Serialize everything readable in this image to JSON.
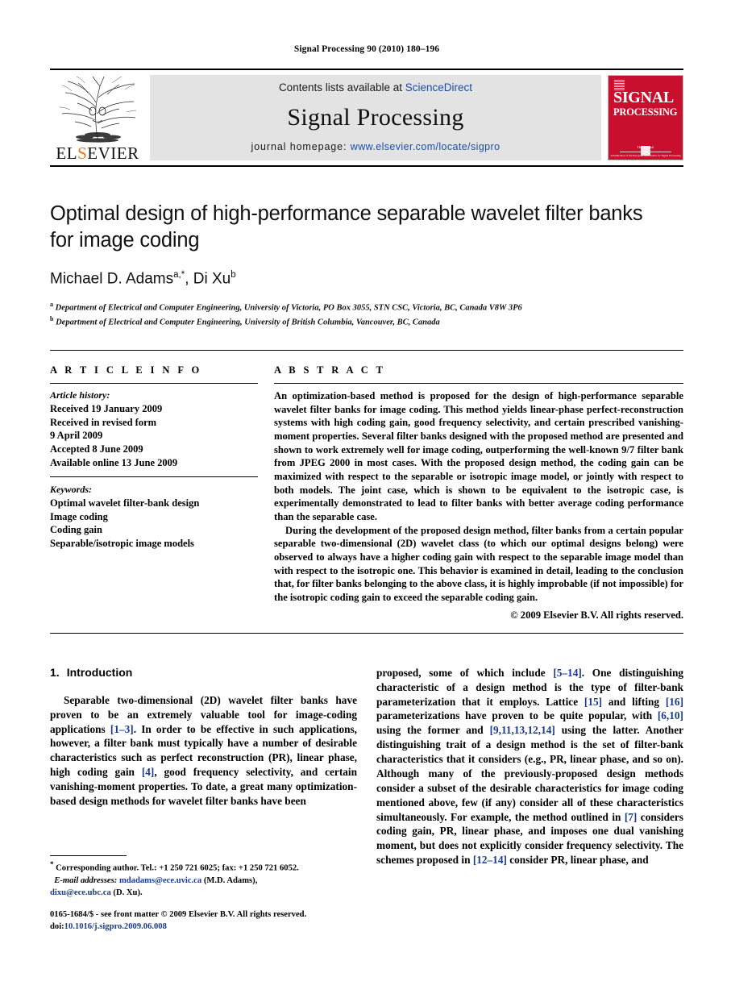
{
  "running_head": "Signal Processing 90 (2010) 180–196",
  "masthead": {
    "publisher": "ELSEVIER",
    "contents_prefix": "Contents lists available at ",
    "contents_link": "ScienceDirect",
    "journal_title": "Signal Processing",
    "homepage_prefix": "journal homepage: ",
    "homepage_url": "www.elsevier.com/locate/sigpro",
    "cover": {
      "line1": "SIGNAL",
      "line2": "PROCESSING",
      "tagline": "The Journal",
      "subtagline": "A Publication of the European Association for Signal Processing"
    },
    "accent_red": "#c8102e",
    "link_blue": "#1c4ea8"
  },
  "article": {
    "title": "Optimal design of high-performance separable wavelet filter banks for image coding",
    "authors": "Michael D. Adams, Di Xu",
    "author_1_name": "Michael D. Adams",
    "author_1_marks": "a,*",
    "author_2_name": "Di Xu",
    "author_2_marks": "b",
    "affiliation_a_mark": "a",
    "affiliation_a": "Department of Electrical and Computer Engineering, University of Victoria, PO Box 3055, STN CSC, Victoria, BC, Canada V8W 3P6",
    "affiliation_b_mark": "b",
    "affiliation_b": "Department of Electrical and Computer Engineering, University of British Columbia, Vancouver, BC, Canada"
  },
  "article_info": {
    "label": "A R T I C L E  I N F O",
    "history_head": "Article history:",
    "history": [
      "Received 19 January 2009",
      "Received in revised form",
      "9 April 2009",
      "Accepted 8 June 2009",
      "Available online 13 June 2009"
    ],
    "keywords_head": "Keywords:",
    "keywords": [
      "Optimal wavelet filter-bank design",
      "Image coding",
      "Coding gain",
      "Separable/isotropic image models"
    ]
  },
  "abstract": {
    "label": "A B S T R A C T",
    "paragraph_1": "An optimization-based method is proposed for the design of high-performance separable wavelet filter banks for image coding. This method yields linear-phase perfect-reconstruction systems with high coding gain, good frequency selectivity, and certain prescribed vanishing-moment properties. Several filter banks designed with the proposed method are presented and shown to work extremely well for image coding, outperforming the well-known 9/7 filter bank from JPEG 2000 in most cases. With the proposed design method, the coding gain can be maximized with respect to the separable or isotropic image model, or jointly with respect to both models. The joint case, which is shown to be equivalent to the isotropic case, is experimentally demonstrated to lead to filter banks with better average coding performance than the separable case.",
    "paragraph_2": "During the development of the proposed design method, filter banks from a certain popular separable two-dimensional (2D) wavelet class (to which our optimal designs belong) were observed to always have a higher coding gain with respect to the separable image model than with respect to the isotropic one. This behavior is examined in detail, leading to the conclusion that, for filter banks belonging to the above class, it is highly improbable (if not impossible) for the isotropic coding gain to exceed the separable coding gain.",
    "copyright": "© 2009 Elsevier B.V. All rights reserved."
  },
  "introduction": {
    "number": "1.",
    "heading": "Introduction",
    "left_text_1": "Separable two-dimensional (2D) wavelet filter banks have proven to be an extremely valuable tool for image-coding applications ",
    "left_cite_1": "[1–3]",
    "left_text_2": ". In order to be effective in such applications, however, a filter bank must typically have a number of desirable characteristics such as perfect reconstruction (PR), linear phase, high coding gain ",
    "left_cite_2": "[4]",
    "left_text_3": ", good frequency selectivity, and certain vanishing-moment properties. To date, a great many optimization-based design methods for wavelet filter banks have been",
    "right_text_1": "proposed, some of which include ",
    "right_cite_1": "[5–14]",
    "right_text_2": ". One distinguishing characteristic of a design method is the type of filter-bank parameterization that it employs. Lattice ",
    "right_cite_2": "[15]",
    "right_text_3": " and lifting ",
    "right_cite_3": "[16]",
    "right_text_4": " parameterizations have proven to be quite popular, with ",
    "right_cite_4": "[6,10]",
    "right_text_5": " using the former and ",
    "right_cite_5": "[9,11,13,12,14]",
    "right_text_6": " using the latter. Another distinguishing trait of a design method is the set of filter-bank characteristics that it considers (e.g., PR, linear phase, and so on). Although many of the previously-proposed design methods consider a subset of the desirable characteristics for image coding mentioned above, few (if any) consider all of these characteristics simultaneously. For example, the method outlined in ",
    "right_cite_6": "[7]",
    "right_text_7": " considers coding gain, PR, linear phase, and imposes one dual vanishing moment, but does not explicitly consider frequency selectivity. The schemes proposed in ",
    "right_cite_7": "[12–14]",
    "right_text_8": " consider PR, linear phase, and"
  },
  "footnote": {
    "marker": "*",
    "corresponding": "Corresponding author. Tel.: +1 250 721 6025; fax: +1 250 721 6052.",
    "email_label": "E-mail addresses:",
    "email_1": "mdadams@ece.uvic.ca",
    "email_1_owner": "(M.D. Adams),",
    "email_2": "dixu@ece.ubc.ca",
    "email_2_owner": "(D. Xu)."
  },
  "imprint": {
    "issn_line": "0165-1684/$ - see front matter © 2009 Elsevier B.V. All rights reserved.",
    "doi_label": "doi:",
    "doi_value": "10.1016/j.sigpro.2009.06.008"
  }
}
